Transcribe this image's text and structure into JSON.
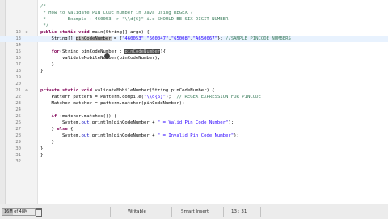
{
  "editor": {
    "lines": [
      {
        "num": "",
        "marker": "",
        "segments": [
          {
            "t": "/*",
            "c": "comment"
          }
        ]
      },
      {
        "num": "",
        "marker": "",
        "segments": [
          {
            "t": " * How to validate PIN CODE number in Java using REGEX ?",
            "c": "comment"
          }
        ]
      },
      {
        "num": "",
        "marker": "",
        "segments": [
          {
            "t": " *        Example : 460053 -> \"\\\\d{6}\" i.e SHOULD BE SIX DIGIT NUMBER",
            "c": "comment"
          }
        ]
      },
      {
        "num": "",
        "marker": "",
        "segments": [
          {
            "t": " */",
            "c": "comment"
          }
        ]
      },
      {
        "num": "12",
        "marker": "⊖",
        "segments": [
          {
            "t": "public static ",
            "c": "kw"
          },
          {
            "t": "void ",
            "c": "kw"
          },
          {
            "t": "main(String[] args) {",
            "c": ""
          }
        ]
      },
      {
        "num": "13",
        "marker": "",
        "segments": [
          {
            "t": "    String[] ",
            "c": ""
          },
          {
            "t": "pinCodeNumber",
            "c": "hl"
          },
          {
            "t": " = {",
            "c": ""
          },
          {
            "t": "\"460053\"",
            "c": "str"
          },
          {
            "t": ",",
            "c": ""
          },
          {
            "t": "\"560047\"",
            "c": "str"
          },
          {
            "t": ",",
            "c": ""
          },
          {
            "t": "\"65008\"",
            "c": "str"
          },
          {
            "t": ",",
            "c": ""
          },
          {
            "t": "\"A650067\"",
            "c": "str"
          },
          {
            "t": "}; ",
            "c": ""
          },
          {
            "t": "//SAMPLE PINCODE NUMBERS",
            "c": "comment"
          }
        ]
      },
      {
        "num": "14",
        "marker": "",
        "segments": [
          {
            "t": "",
            "c": ""
          }
        ]
      },
      {
        "num": "15",
        "marker": "",
        "segments": [
          {
            "t": "    ",
            "c": ""
          },
          {
            "t": "for",
            "c": "kw"
          },
          {
            "t": "(String pinCodeNumber : ",
            "c": ""
          },
          {
            "t": "pinCodeNumber",
            "c": "hl-dark"
          },
          {
            "t": "){",
            "c": ""
          }
        ]
      },
      {
        "num": "16",
        "marker": "",
        "segments": [
          {
            "t": "        validateMobileNumber(pinCodeNumber);",
            "c": ""
          }
        ]
      },
      {
        "num": "17",
        "marker": "",
        "segments": [
          {
            "t": "    }",
            "c": ""
          }
        ]
      },
      {
        "num": "18",
        "marker": "",
        "segments": [
          {
            "t": "}",
            "c": ""
          }
        ]
      },
      {
        "num": "19",
        "marker": "",
        "segments": [
          {
            "t": "",
            "c": ""
          }
        ]
      },
      {
        "num": "20",
        "marker": "",
        "segments": [
          {
            "t": "",
            "c": ""
          }
        ]
      },
      {
        "num": "21",
        "marker": "⊖",
        "segments": [
          {
            "t": "private ",
            "c": "kw"
          },
          {
            "t": "static ",
            "c": "kw"
          },
          {
            "t": "void ",
            "c": "kw"
          },
          {
            "t": "validateMobileNumber(String pinCodeNumber) {",
            "c": ""
          }
        ]
      },
      {
        "num": "22",
        "marker": "",
        "segments": [
          {
            "t": "    Pattern pattern = Pattern.",
            "c": ""
          },
          {
            "t": "compile",
            "c": ""
          },
          {
            "t": "(",
            "c": ""
          },
          {
            "t": "\"\\\\d{6}\"",
            "c": "str"
          },
          {
            "t": ");  ",
            "c": ""
          },
          {
            "t": "// REGEX EXPRESSION FOR PINCODE",
            "c": "comment"
          }
        ]
      },
      {
        "num": "23",
        "marker": "",
        "segments": [
          {
            "t": "    Matcher matcher = pattern.matcher(pinCodeNumber);",
            "c": ""
          }
        ]
      },
      {
        "num": "24",
        "marker": "",
        "segments": [
          {
            "t": "",
            "c": ""
          }
        ]
      },
      {
        "num": "25",
        "marker": "",
        "segments": [
          {
            "t": "    ",
            "c": ""
          },
          {
            "t": "if",
            "c": "kw"
          },
          {
            "t": " (matcher.matches()) {",
            "c": ""
          }
        ]
      },
      {
        "num": "26",
        "marker": "",
        "segments": [
          {
            "t": "        System.",
            "c": ""
          },
          {
            "t": "out",
            "c": "field"
          },
          {
            "t": ".println(pinCodeNumber + ",
            "c": ""
          },
          {
            "t": "\" = Valid Pin Code Number\"",
            "c": "str"
          },
          {
            "t": ");",
            "c": ""
          }
        ]
      },
      {
        "num": "27",
        "marker": "",
        "segments": [
          {
            "t": "    } ",
            "c": ""
          },
          {
            "t": "else",
            "c": "kw"
          },
          {
            "t": " {",
            "c": ""
          }
        ]
      },
      {
        "num": "28",
        "marker": "",
        "segments": [
          {
            "t": "        System.",
            "c": ""
          },
          {
            "t": "out",
            "c": "field"
          },
          {
            "t": ".println(pinCodeNumber + ",
            "c": ""
          },
          {
            "t": "\" = Invalid Pin Code Number\"",
            "c": "str"
          },
          {
            "t": ");",
            "c": ""
          }
        ]
      },
      {
        "num": "29",
        "marker": "",
        "segments": [
          {
            "t": "    }",
            "c": ""
          }
        ]
      },
      {
        "num": "30",
        "marker": "",
        "segments": [
          {
            "t": "}",
            "c": ""
          }
        ]
      },
      {
        "num": "31",
        "marker": "",
        "segments": [
          {
            "t": "}",
            "c": ""
          }
        ]
      },
      {
        "num": "32",
        "marker": "",
        "segments": [
          {
            "t": "",
            "c": ""
          }
        ]
      },
      {
        "num": "",
        "marker": "",
        "segments": [
          {
            "t": "",
            "c": ""
          }
        ]
      }
    ]
  },
  "statusbar": {
    "memory": "16M of 48M",
    "memory_fraction": 0.33,
    "writable": "Writable",
    "insert_mode": "Smart Insert",
    "position": "13 : 31"
  }
}
